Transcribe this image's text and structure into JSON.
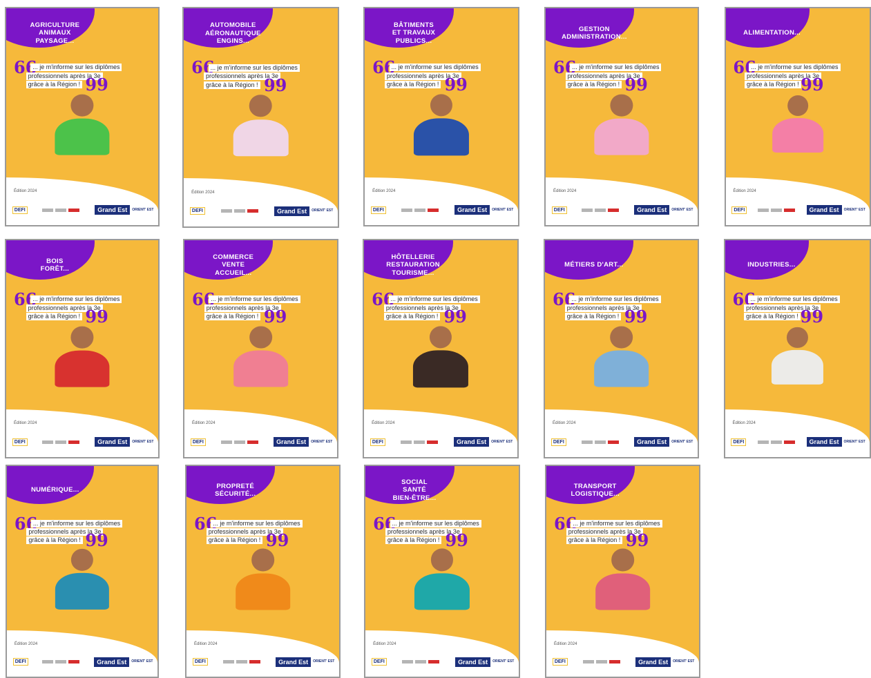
{
  "quote": {
    "line1": "... je m'informe sur les diplômes",
    "line2": "professionnels après la 3e",
    "line3": "grâce à la Région !",
    "open_mark": "66",
    "close_mark": "99"
  },
  "edition": "Édition 2024",
  "footer": {
    "defi_label": "DEFI",
    "region_label": "Grand Est",
    "orient_label": "ORIENT' EST"
  },
  "colors": {
    "card_bg": "#f6b93b",
    "bubble": "#7b16c7",
    "region_badge": "#1b2f7a"
  },
  "cards": [
    {
      "title": "AGRICULTURE\nANIMAUX\nPAYSAGE...",
      "shirt": "#4cc24a"
    },
    {
      "title": "AUTOMOBILE\nAÉRONAUTIQUE\nENGINS...",
      "shirt": "#f0d6e6"
    },
    {
      "title": "BÂTIMENTS\nET TRAVAUX\nPUBLICS...",
      "shirt": "#2a52a8"
    },
    {
      "title": "GESTION\nADMINISTRATION...",
      "shirt": "#f2a9c8"
    },
    {
      "title": "ALIMENTATION...",
      "shirt": "#f47fa6"
    },
    {
      "title": "BOIS\nFORÊT...",
      "shirt": "#d8322f"
    },
    {
      "title": "COMMERCE\nVENTE\nACCUEIL...",
      "shirt": "#f07f92"
    },
    {
      "title": "HÔTELLERIE\nRESTAURATION\nTOURISME...",
      "shirt": "#3a2a25"
    },
    {
      "title": "MÉTIERS D'ART...",
      "shirt": "#7fb0d8"
    },
    {
      "title": "INDUSTRIES...",
      "shirt": "#ecebe8"
    },
    {
      "title": "NUMÉRIQUE...",
      "shirt": "#2a8fb0"
    },
    {
      "title": "PROPRETÉ\nSÉCURITÉ...",
      "shirt": "#f08a1a"
    },
    {
      "title": "SOCIAL\nSANTÉ\nBIEN-ÊTRE...",
      "shirt": "#1fa8a8"
    },
    {
      "title": "TRANSPORT\nLOGISTIQUE...",
      "shirt": "#e0607a"
    }
  ]
}
